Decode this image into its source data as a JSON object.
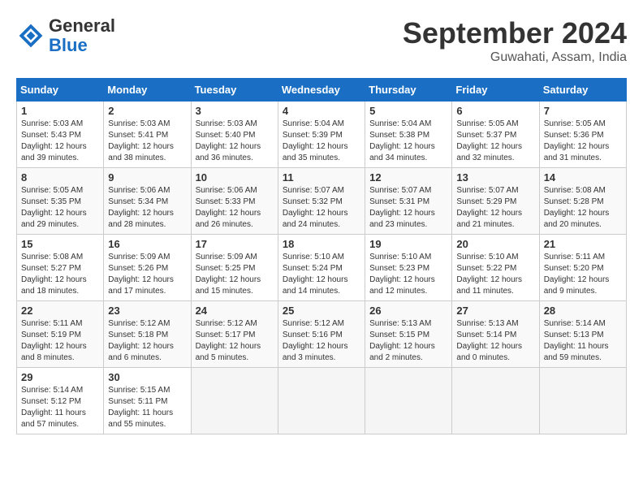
{
  "logo": {
    "line1": "General",
    "line2": "Blue"
  },
  "title": "September 2024",
  "location": "Guwahati, Assam, India",
  "weekdays": [
    "Sunday",
    "Monday",
    "Tuesday",
    "Wednesday",
    "Thursday",
    "Friday",
    "Saturday"
  ],
  "weeks": [
    [
      {
        "day": "1",
        "info": "Sunrise: 5:03 AM\nSunset: 5:43 PM\nDaylight: 12 hours\nand 39 minutes."
      },
      {
        "day": "2",
        "info": "Sunrise: 5:03 AM\nSunset: 5:41 PM\nDaylight: 12 hours\nand 38 minutes."
      },
      {
        "day": "3",
        "info": "Sunrise: 5:03 AM\nSunset: 5:40 PM\nDaylight: 12 hours\nand 36 minutes."
      },
      {
        "day": "4",
        "info": "Sunrise: 5:04 AM\nSunset: 5:39 PM\nDaylight: 12 hours\nand 35 minutes."
      },
      {
        "day": "5",
        "info": "Sunrise: 5:04 AM\nSunset: 5:38 PM\nDaylight: 12 hours\nand 34 minutes."
      },
      {
        "day": "6",
        "info": "Sunrise: 5:05 AM\nSunset: 5:37 PM\nDaylight: 12 hours\nand 32 minutes."
      },
      {
        "day": "7",
        "info": "Sunrise: 5:05 AM\nSunset: 5:36 PM\nDaylight: 12 hours\nand 31 minutes."
      }
    ],
    [
      {
        "day": "8",
        "info": "Sunrise: 5:05 AM\nSunset: 5:35 PM\nDaylight: 12 hours\nand 29 minutes."
      },
      {
        "day": "9",
        "info": "Sunrise: 5:06 AM\nSunset: 5:34 PM\nDaylight: 12 hours\nand 28 minutes."
      },
      {
        "day": "10",
        "info": "Sunrise: 5:06 AM\nSunset: 5:33 PM\nDaylight: 12 hours\nand 26 minutes."
      },
      {
        "day": "11",
        "info": "Sunrise: 5:07 AM\nSunset: 5:32 PM\nDaylight: 12 hours\nand 24 minutes."
      },
      {
        "day": "12",
        "info": "Sunrise: 5:07 AM\nSunset: 5:31 PM\nDaylight: 12 hours\nand 23 minutes."
      },
      {
        "day": "13",
        "info": "Sunrise: 5:07 AM\nSunset: 5:29 PM\nDaylight: 12 hours\nand 21 minutes."
      },
      {
        "day": "14",
        "info": "Sunrise: 5:08 AM\nSunset: 5:28 PM\nDaylight: 12 hours\nand 20 minutes."
      }
    ],
    [
      {
        "day": "15",
        "info": "Sunrise: 5:08 AM\nSunset: 5:27 PM\nDaylight: 12 hours\nand 18 minutes."
      },
      {
        "day": "16",
        "info": "Sunrise: 5:09 AM\nSunset: 5:26 PM\nDaylight: 12 hours\nand 17 minutes."
      },
      {
        "day": "17",
        "info": "Sunrise: 5:09 AM\nSunset: 5:25 PM\nDaylight: 12 hours\nand 15 minutes."
      },
      {
        "day": "18",
        "info": "Sunrise: 5:10 AM\nSunset: 5:24 PM\nDaylight: 12 hours\nand 14 minutes."
      },
      {
        "day": "19",
        "info": "Sunrise: 5:10 AM\nSunset: 5:23 PM\nDaylight: 12 hours\nand 12 minutes."
      },
      {
        "day": "20",
        "info": "Sunrise: 5:10 AM\nSunset: 5:22 PM\nDaylight: 12 hours\nand 11 minutes."
      },
      {
        "day": "21",
        "info": "Sunrise: 5:11 AM\nSunset: 5:20 PM\nDaylight: 12 hours\nand 9 minutes."
      }
    ],
    [
      {
        "day": "22",
        "info": "Sunrise: 5:11 AM\nSunset: 5:19 PM\nDaylight: 12 hours\nand 8 minutes."
      },
      {
        "day": "23",
        "info": "Sunrise: 5:12 AM\nSunset: 5:18 PM\nDaylight: 12 hours\nand 6 minutes."
      },
      {
        "day": "24",
        "info": "Sunrise: 5:12 AM\nSunset: 5:17 PM\nDaylight: 12 hours\nand 5 minutes."
      },
      {
        "day": "25",
        "info": "Sunrise: 5:12 AM\nSunset: 5:16 PM\nDaylight: 12 hours\nand 3 minutes."
      },
      {
        "day": "26",
        "info": "Sunrise: 5:13 AM\nSunset: 5:15 PM\nDaylight: 12 hours\nand 2 minutes."
      },
      {
        "day": "27",
        "info": "Sunrise: 5:13 AM\nSunset: 5:14 PM\nDaylight: 12 hours\nand 0 minutes."
      },
      {
        "day": "28",
        "info": "Sunrise: 5:14 AM\nSunset: 5:13 PM\nDaylight: 11 hours\nand 59 minutes."
      }
    ],
    [
      {
        "day": "29",
        "info": "Sunrise: 5:14 AM\nSunset: 5:12 PM\nDaylight: 11 hours\nand 57 minutes."
      },
      {
        "day": "30",
        "info": "Sunrise: 5:15 AM\nSunset: 5:11 PM\nDaylight: 11 hours\nand 55 minutes."
      },
      {
        "day": "",
        "info": ""
      },
      {
        "day": "",
        "info": ""
      },
      {
        "day": "",
        "info": ""
      },
      {
        "day": "",
        "info": ""
      },
      {
        "day": "",
        "info": ""
      }
    ]
  ]
}
